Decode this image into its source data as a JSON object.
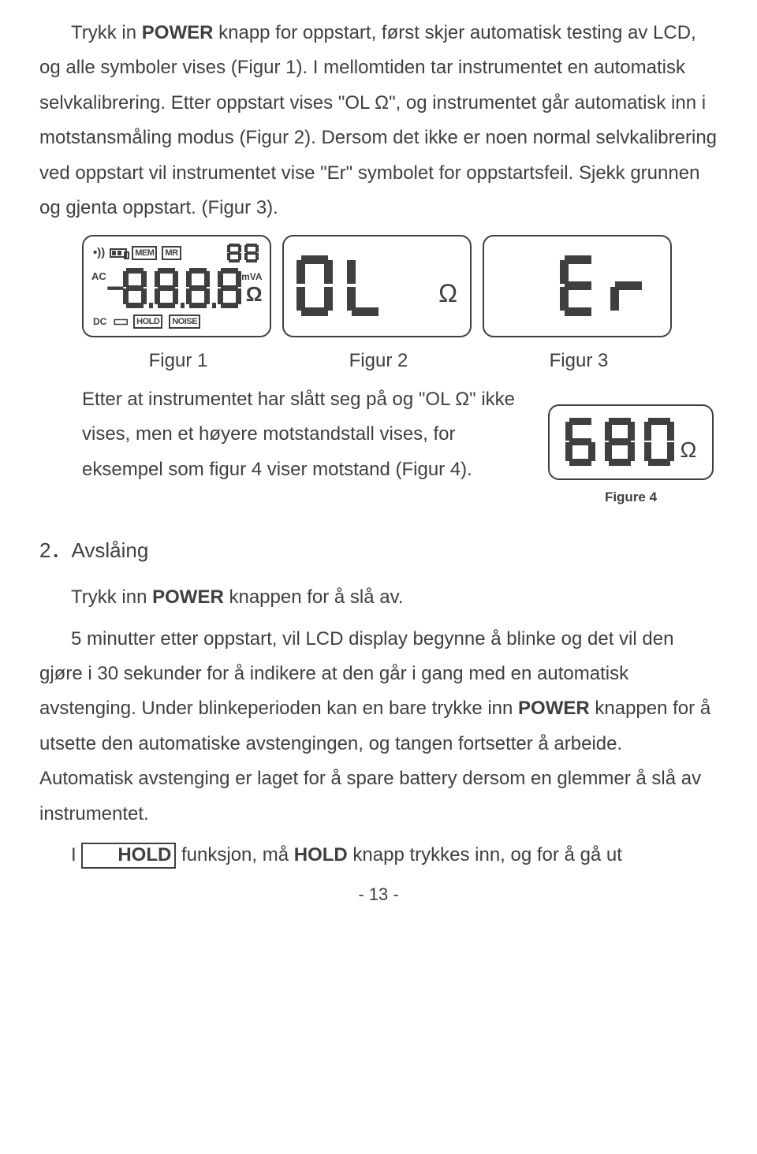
{
  "para1": {
    "seg1": "Trykk in ",
    "power": "POWER",
    "seg2": " knapp for oppstart, først skjer automatisk testing av LCD, og alle symboler vises (Figur 1). I mellomtiden tar instrumentet en automatisk selvkalibrering. Etter oppstart vises \"OL Ω\", og instrumentet går automatisk inn i motstansmåling modus (Figur 2). Dersom det ikke er noen normal selvkalibrering ved oppstart vil instrumentet vise \"Er\" symbolet for oppstartsfeil. Sjekk grunnen og gjenta oppstart. (Figur 3)."
  },
  "fig1": {
    "mem": "MEM",
    "mr": "MR",
    "top88": "88",
    "ac": "AC",
    "mva": "mVA",
    "ohm": "Ω",
    "dc": "DC",
    "hold": "HOLD",
    "noise": "NOISE"
  },
  "fig2": {
    "ohm": "Ω"
  },
  "fig_captions": {
    "f1": "Figur 1",
    "f2": "Figur 2",
    "f3": "Figur 3"
  },
  "after": {
    "text": "Etter at instrumentet har slått seg på og \"OL Ω\" ikke vises, men et høyere motstandstall vises, for eksempel som figur 4 viser motstand (Figur 4)."
  },
  "fig4": {
    "ohm": "Ω",
    "caption": "Figure 4"
  },
  "section2": {
    "num": "2",
    "dot": "．",
    "title": "Avslåing"
  },
  "para2": {
    "seg1": "Trykk inn ",
    "power": "POWER",
    "seg2": " knappen for å slå av."
  },
  "para3": {
    "seg1": "5 minutter etter oppstart, vil LCD display begynne å blinke og det vil den gjøre i 30 sekunder for å indikere at den går i gang med en automatisk avstenging. Under blinkeperioden kan en bare trykke inn ",
    "power": "POWER",
    "seg2": " knappen for å utsette den automatiske avstengingen, og tangen fortsetter å arbeide. Automatisk avstenging er laget for å spare battery dersom en glemmer å slå av instrumentet."
  },
  "para4": {
    "seg1": "I ",
    "hold": "HOLD",
    "seg2": " funksjon, må ",
    "hold2": "HOLD",
    "seg3": " knapp trykkes inn, og for å gå ut"
  },
  "pagenum": "- 13 -"
}
